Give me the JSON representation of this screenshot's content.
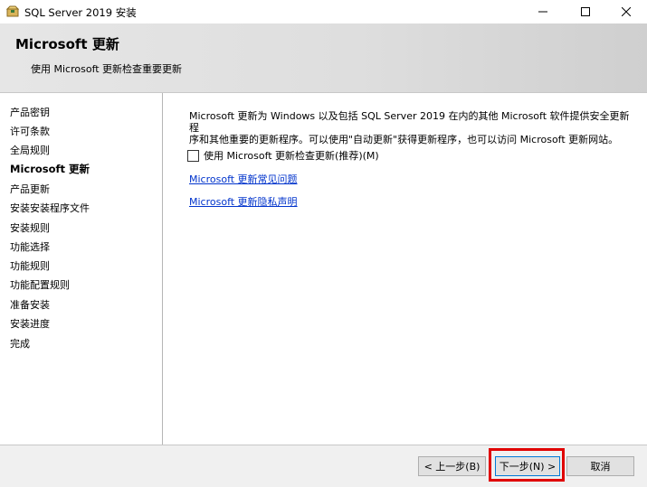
{
  "window": {
    "title": "SQL Server 2019 安装"
  },
  "header": {
    "title": "Microsoft 更新",
    "subtitle": "使用 Microsoft 更新检查重要更新"
  },
  "sidebar": {
    "items": [
      {
        "label": "产品密钥"
      },
      {
        "label": "许可条款"
      },
      {
        "label": "全局规则"
      },
      {
        "label": "Microsoft 更新",
        "active": true
      },
      {
        "label": "产品更新"
      },
      {
        "label": "安装安装程序文件"
      },
      {
        "label": "安装规则"
      },
      {
        "label": "功能选择"
      },
      {
        "label": "功能规则"
      },
      {
        "label": "功能配置规则"
      },
      {
        "label": "准备安装"
      },
      {
        "label": "安装进度"
      },
      {
        "label": "完成"
      }
    ]
  },
  "main": {
    "description_line1": "Microsoft 更新为 Windows 以及包括 SQL Server 2019 在内的其他 Microsoft 软件提供安全更新程",
    "description_line2": "序和其他重要的更新程序。可以使用\"自动更新\"获得更新程序，也可以访问 Microsoft 更新网站。",
    "checkbox": {
      "label": "使用 Microsoft 更新检查更新(推荐)(M)",
      "checked": false
    },
    "links": {
      "faq": "Microsoft 更新常见问题",
      "privacy": "Microsoft 更新隐私声明"
    }
  },
  "footer": {
    "back_label": "< 上一步(B)",
    "next_label": "下一步(N) >",
    "cancel_label": "取消"
  },
  "colors": {
    "link": "#0033cc",
    "highlight": "#e00000",
    "focus_border": "#0078d7"
  },
  "icons": {
    "app": "sql-setup-box-icon",
    "minimize": "minimize-icon",
    "maximize": "maximize-icon",
    "close": "close-icon"
  }
}
